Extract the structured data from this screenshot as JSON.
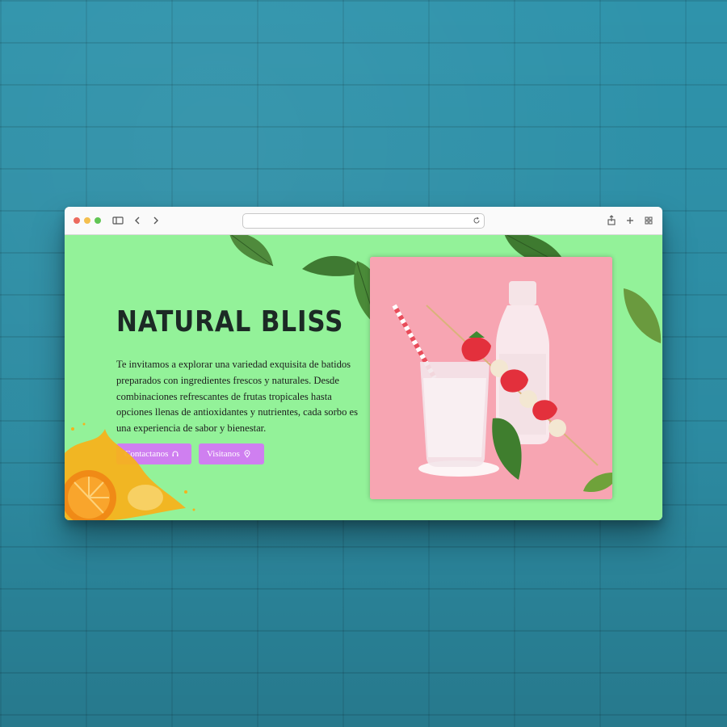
{
  "browser": {
    "address_value": "",
    "icons": [
      "sidebar-icon",
      "back-icon",
      "forward-icon",
      "reload-icon",
      "share-icon",
      "new-tab-icon",
      "tab-overview-icon"
    ]
  },
  "hero": {
    "title": "NATURAL BLISS",
    "description": "Te invitamos a explorar una variedad exquisita de batidos preparados con ingredientes frescos y naturales. Desde combinaciones refrescantes de frutas tropicales hasta opciones llenas de antioxidantes y nutrientes, cada sorbo es una experiencia de sabor y bienestar.",
    "buttons": {
      "contact_label": "Contactanos",
      "visit_label": "Visitanos"
    }
  },
  "colors": {
    "page_background": "#93f299",
    "button": "#cf7ff0",
    "photo_background": "#f6a4b0",
    "wall": "#2f93ab"
  }
}
